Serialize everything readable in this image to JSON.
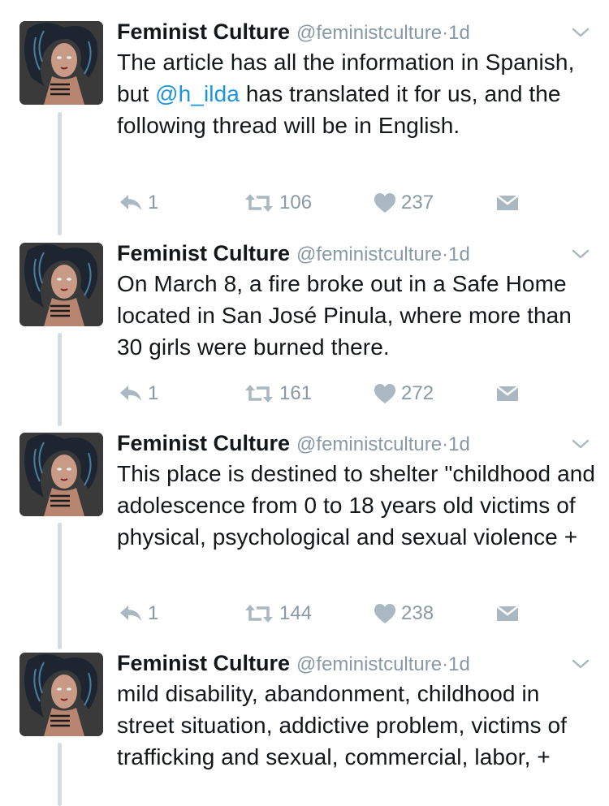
{
  "colors": {
    "text": "#14171a",
    "muted": "#8899a6",
    "link": "#1b95e0",
    "thread_line": "#d3dce3"
  },
  "icons": {
    "reply": "reply-icon",
    "retweet": "retweet-icon",
    "like": "heart-icon",
    "message": "direct-message-icon",
    "menu": "chevron-down-icon"
  },
  "tweets": [
    {
      "author_name": "Feminist Culture",
      "handle": "@feministculture",
      "separator": "·",
      "time": "1d",
      "text_before": "The article has all the information in Spanish, but ",
      "mention": "@h_ilda",
      "text_after": " has translated it for us, and the following thread will be in English.",
      "replies": "1",
      "retweets": "106",
      "likes": "237"
    },
    {
      "author_name": "Feminist Culture",
      "handle": "@feministculture",
      "separator": "·",
      "time": "1d",
      "text": "On March 8, a fire broke out in a Safe Home located in San José Pinula, where more than 30 girls were burned there.",
      "replies": "1",
      "retweets": "161",
      "likes": "272"
    },
    {
      "author_name": "Feminist Culture",
      "handle": "@feministculture",
      "separator": "·",
      "time": "1d",
      "text": "This place is destined to shelter \"childhood and adolescence from 0 to 18 years old victims of physical, psychological and sexual violence +",
      "replies": "1",
      "retweets": "144",
      "likes": "238"
    },
    {
      "author_name": "Feminist Culture",
      "handle": "@feministculture",
      "separator": "·",
      "time": "1d",
      "text": "mild disability, abandonment, childhood in street situation, addictive problem, victims of trafficking and sexual, commercial, labor, +"
    }
  ]
}
